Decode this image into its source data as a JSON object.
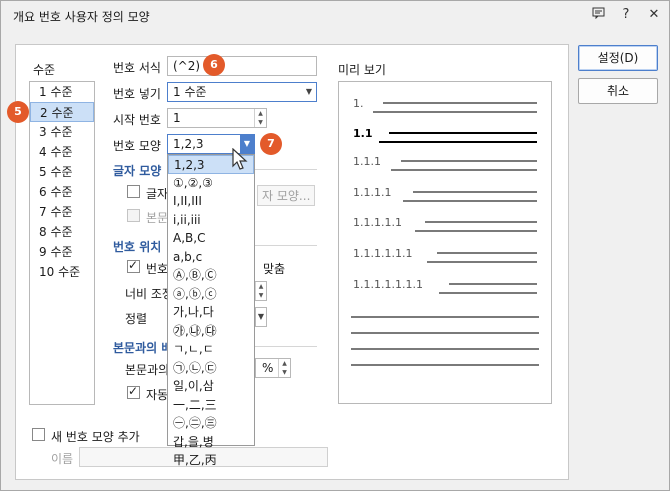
{
  "window": {
    "title": "개요 번호 사용자 정의 모양",
    "icons": [
      "help-chat-icon",
      "question-icon",
      "close-icon"
    ],
    "help_glyph": "?",
    "close_glyph": "✕"
  },
  "levels": {
    "heading": "수준",
    "items": [
      "1 수준",
      "2 수준",
      "3 수준",
      "4 수준",
      "5 수준",
      "6 수준",
      "7 수준",
      "8 수준",
      "9 수준",
      "10 수준"
    ],
    "selected_index": 1
  },
  "number_format": {
    "format_label": "번호 서식",
    "format_value": "(^2)",
    "insert_label": "번호 넣기",
    "insert_value": "1 수준",
    "start_label": "시작 번호",
    "start_value": "1",
    "shape_label": "번호 모양",
    "shape_value": "1,2,3"
  },
  "char_shape": {
    "heading": "글자 모양",
    "char_label": "글자",
    "body_label": "본문",
    "button": "자 모양..."
  },
  "number_position": {
    "heading": "번호 위치",
    "check_label": "번호",
    "align_suffix": "맞춤",
    "width_label": "너비 조정",
    "align_label": "정렬"
  },
  "body_spacing": {
    "heading": "본문과의 배",
    "distance_label": "본문과의",
    "unit": "%",
    "auto_label": "자동"
  },
  "dropdown": {
    "options": [
      "1,2,3",
      "①,②,③",
      "I,II,III",
      "i,ii,iii",
      "A,B,C",
      "a,b,c",
      "Ⓐ,Ⓑ,Ⓒ",
      "ⓐ,ⓑ,ⓒ",
      "가,나,다",
      "㉮,㉯,㉰",
      "ㄱ,ㄴ,ㄷ",
      "㉠,㉡,㉢",
      "일,이,삼",
      "一,二,三",
      "㊀,㊁,㊂",
      "갑,을,병",
      "甲,乙,丙"
    ],
    "selected_index": 0
  },
  "preview": {
    "heading": "미리 보기",
    "rows": [
      "1.",
      "1.1",
      "1.1.1",
      "1.1.1.1",
      "1.1.1.1.1",
      "1.1.1.1.1.1",
      "1.1.1.1.1.1.1"
    ],
    "active_row": 1
  },
  "add_shape": {
    "check_label": "새 번호 모양 추가",
    "name_label": "이름",
    "name_value": ""
  },
  "buttons": {
    "ok": "설정(D)",
    "cancel": "취소"
  },
  "badges": {
    "levels": "5",
    "format": "6",
    "shape": "7"
  },
  "colors": {
    "badge": "#e35a2a",
    "selection": "#cce0f7",
    "heading": "#2f5b9e"
  }
}
